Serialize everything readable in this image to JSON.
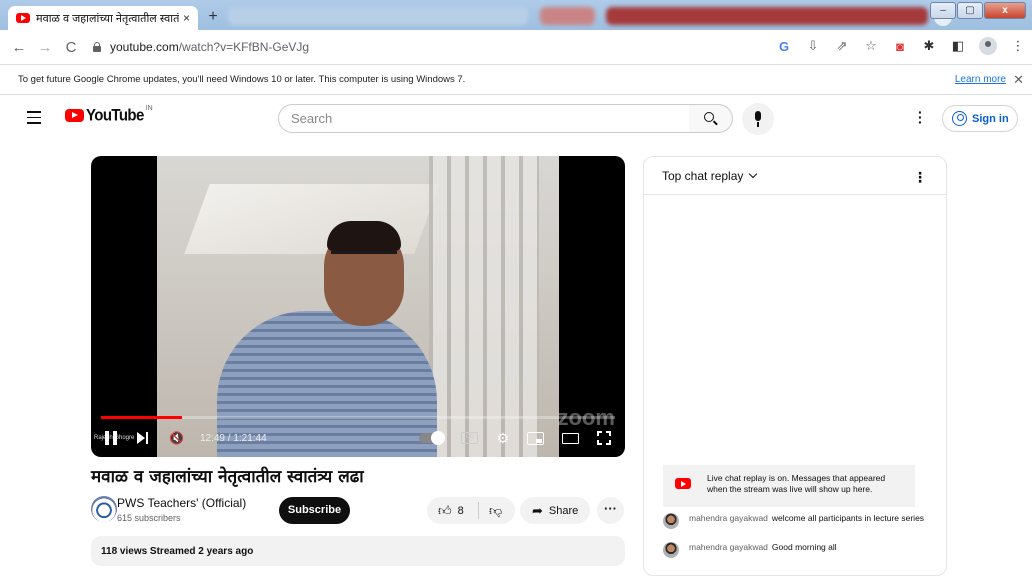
{
  "browser": {
    "tab_title": "मवाळ व जहालांच्या नेतृत्वातील स्वातं",
    "tab_close": "×",
    "new_tab": "+",
    "tab_dropdown": "⌄",
    "window_buttons": [
      "–",
      "▢",
      "x"
    ],
    "url_domain": "youtube.com",
    "url_path": "/watch?v=KFfBN-GeVJg",
    "colors": {
      "tabstrip": "#a9c6e6",
      "accent": "#1a73e8"
    },
    "icons": [
      "google-icon",
      "download-icon",
      "share-icon",
      "star-icon",
      "extension-icon",
      "puzzle-icon",
      "sidepanel-icon",
      "profile-icon",
      "menu-icon"
    ]
  },
  "infobar": {
    "message": "To get future Google Chrome updates, you'll need Windows 10 or later. This computer is using Windows 7.",
    "link": "Learn more",
    "close": "✕"
  },
  "youtube": {
    "logo_text": "YouTube",
    "country": "IN",
    "search_placeholder": "Search",
    "sign_in": "Sign in",
    "brand_color": "#ff0000"
  },
  "player": {
    "time": "12:49 / 1:21:44",
    "progress_fraction": 0.157,
    "watermark": "Rajesh Ghogre",
    "zoom_mark": "zoom",
    "cc_label": "CC"
  },
  "video": {
    "title": "मवाळ व जहालांच्या नेतृत्वातील स्वातंत्र्य लढा",
    "channel_name": "PWS Teachers' (Official)",
    "subscribers": "615 subscribers",
    "subscribe_label": "Subscribe",
    "likes": "8",
    "share_label": "Share",
    "more_label": "···",
    "meta": "118 views  Streamed 2 years ago"
  },
  "chat": {
    "header": "Top chat replay",
    "notice": "Live chat replay is on. Messages that appeared when the stream was live will show up here.",
    "messages": [
      {
        "author": "mahendra gayakwad",
        "text": "welcome all participants in lecture series"
      },
      {
        "author": "mahendra gayakwad",
        "text": "Good morning all"
      }
    ]
  }
}
